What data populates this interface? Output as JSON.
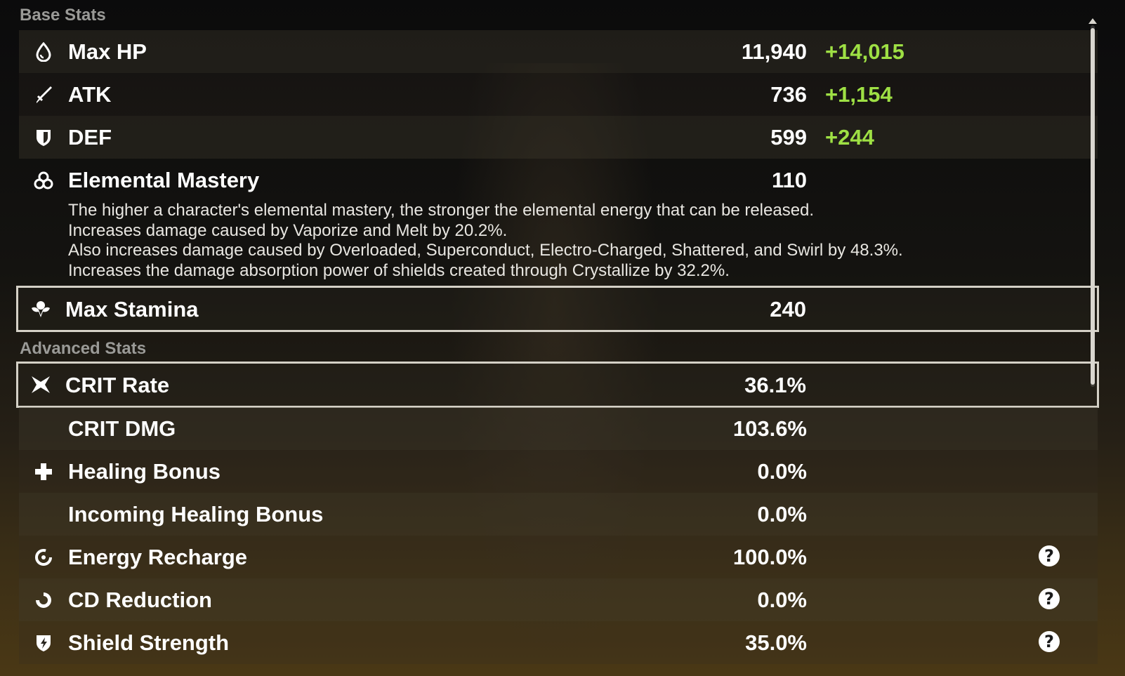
{
  "base_stats": {
    "title": "Base Stats",
    "rows": [
      {
        "label": "Max HP",
        "value": "11,940",
        "bonus": "+14,015",
        "icon": "hp-drop-icon"
      },
      {
        "label": "ATK",
        "value": "736",
        "bonus": "+1,154",
        "icon": "sword-icon"
      },
      {
        "label": "DEF",
        "value": "599",
        "bonus": "+244",
        "icon": "shield-icon"
      }
    ],
    "elemental_mastery": {
      "label": "Elemental Mastery",
      "value": "110",
      "icon": "elemental-mastery-icon",
      "description": [
        "The higher a character's elemental mastery, the stronger the elemental energy that can be released.",
        "Increases damage caused by Vaporize and Melt by 20.2%.",
        "Also increases damage caused by Overloaded, Superconduct, Electro-Charged, Shattered, and Swirl by 48.3%.",
        "Increases the damage absorption power of shields created through Crystallize by 32.2%."
      ]
    },
    "stamina": {
      "label": "Max Stamina",
      "value": "240",
      "icon": "stamina-icon"
    }
  },
  "advanced_stats": {
    "title": "Advanced Stats",
    "rows": [
      {
        "label": "CRIT Rate",
        "value": "36.1%",
        "icon": "crit-rate-icon"
      },
      {
        "label": "CRIT DMG",
        "value": "103.6%"
      },
      {
        "label": "Healing Bonus",
        "value": "0.0%",
        "icon": "plus-cross-icon"
      },
      {
        "label": "Incoming Healing Bonus",
        "value": "0.0%"
      },
      {
        "label": "Energy Recharge",
        "value": "100.0%",
        "icon": "energy-recharge-icon",
        "help": "?"
      },
      {
        "label": "CD Reduction",
        "value": "0.0%",
        "icon": "cd-reduction-icon",
        "help": "?"
      },
      {
        "label": "Shield Strength",
        "value": "35.0%",
        "icon": "shield-strength-icon",
        "help": "?"
      }
    ]
  },
  "colors": {
    "bonus_green": "#9ee044",
    "selected_border": "#d4d0c6",
    "section_title": "#9a9a97"
  }
}
